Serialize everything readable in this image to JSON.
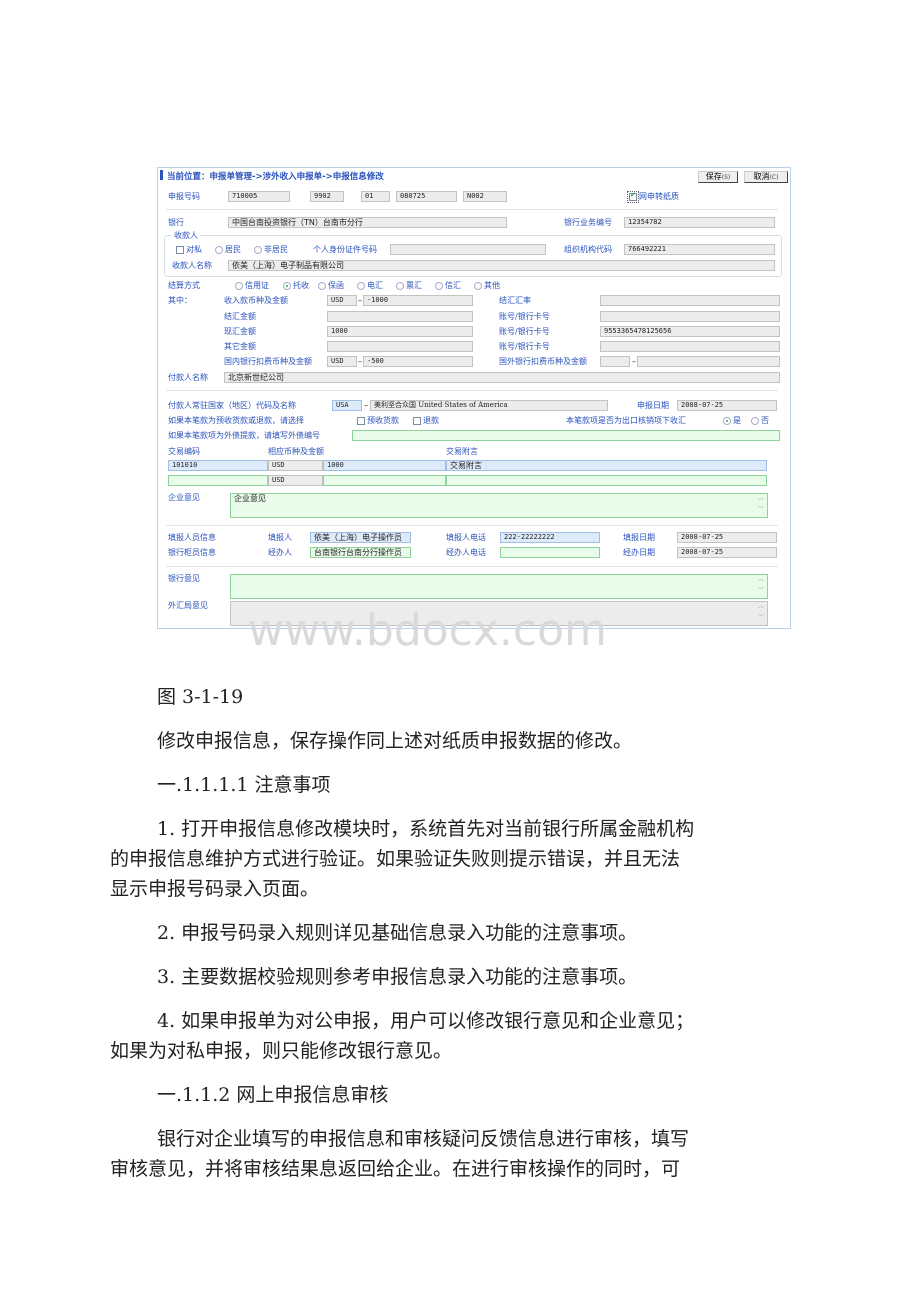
{
  "form": {
    "breadcrumb": "当前位置：申报单管理->涉外收入申报单->申报信息修改",
    "buttons": {
      "save": "保存",
      "save_key": "(S)",
      "cancel": "取消",
      "cancel_key": "(C)"
    },
    "declaration_no": {
      "label": "申报号码",
      "parts": [
        "710005",
        "9902",
        "01",
        "080725",
        "N002"
      ]
    },
    "paper_convert": {
      "label": "网申转纸质",
      "checked": true
    },
    "bank": {
      "label": "银行",
      "value": "中国台南投资银行（TN）台南市分行",
      "biz_no_label": "银行业务编号",
      "biz_no": "12354782"
    },
    "payee": {
      "group_label": "收款人",
      "private_label": "对私",
      "private_checked": false,
      "resident_label": "居民",
      "nonresident_label": "非居民",
      "id_label": "个人身份证件号码",
      "id_value": "",
      "org_code_label": "组织机构代码",
      "org_code": "766492221",
      "name_label": "收款人名称",
      "name": "依美（上海）电子制品有限公司"
    },
    "settlement": {
      "label": "结算方式",
      "options": [
        "信用证",
        "托收",
        "保函",
        "电汇",
        "票汇",
        "信汇",
        "其他"
      ],
      "selected": "托收"
    },
    "amounts": {
      "section_label": "其中：",
      "income_label": "收入款币种及金额",
      "income_currency": "USD",
      "income_amount": "-1000",
      "fx_rate_label": "结汇汇率",
      "fx_rate": "",
      "settle_label": "结汇金额",
      "settle_value": "",
      "account_label_1": "账号/银行卡号",
      "account_1": "",
      "spot_label": "现汇金额",
      "spot_value": "1000",
      "account_label_2": "账号/银行卡号",
      "account_2": "9553365478125656",
      "other_label": "其它金额",
      "other_value": "",
      "account_label_3": "账号/银行卡号",
      "account_3": "",
      "domestic_fee_label": "国内银行扣费币种及金额",
      "domestic_fee_currency": "USD",
      "domestic_fee_amount": "-500",
      "foreign_fee_label": "国外银行扣费币种及金额",
      "foreign_fee_currency": "",
      "foreign_fee_amount": ""
    },
    "payer": {
      "label": "付款人名称",
      "value": "北京新世纪公司"
    },
    "country": {
      "label": "付款人常驻国家（地区）代码及名称",
      "code": "USA",
      "name": "美利坚合众国 United States of America",
      "date_label": "申报日期",
      "date": "2008-07-25"
    },
    "advance": {
      "label": "如果本笔款为预收货款或退款，请选择",
      "advance_label": "预收货款",
      "refund_label": "退款",
      "export_label": "本笔款项是否为出口核销项下收汇",
      "yes": "是",
      "no": "否",
      "export_selected": "是"
    },
    "foreign_debt": {
      "label": "如果本笔款项为外债提款，请填写外债编号",
      "value": ""
    },
    "transaction": {
      "code_header": "交易编码",
      "amount_header": "相应币种及金额",
      "note_header": "交易附言",
      "rows": [
        {
          "code": "101010",
          "currency": "USD",
          "amount": "1000",
          "note": "交易附言"
        },
        {
          "code": "",
          "currency": "USD",
          "amount": "",
          "note": ""
        }
      ]
    },
    "enterprise_opinion": {
      "label": "企业意见",
      "value": "企业意见"
    },
    "filler": {
      "section": "填报人员信息",
      "label": "填报人",
      "value": "依美（上海）电子操作员",
      "phone_label": "填报人电话",
      "phone": "222-22222222",
      "date_label": "填报日期",
      "date": "2008-07-25"
    },
    "clerk": {
      "section": "银行柜员信息",
      "label": "经办人",
      "value": "台南银行台南分行操作员",
      "phone_label": "经办人电话",
      "phone": "",
      "date_label": "经办日期",
      "date": "2008-07-25"
    },
    "bank_opinion": {
      "label": "银行意见",
      "value": ""
    },
    "safe_opinion": {
      "label": "外汇局意见",
      "value": ""
    }
  },
  "watermark": "www.bdocx.com",
  "document": {
    "caption": "图 3-1-19",
    "p1": "修改申报信息，保存操作同上述对纸质申报数据的修改。",
    "h1": "一.1.1.1.1 注意事项",
    "item1_line1": "1. 打开申报信息修改模块时，系统首先对当前银行所属金融机构",
    "item1_line2": "的申报信息维护方式进行验证。如果验证失败则提示错误，并且无法",
    "item1_line3": "显示申报号码录入页面。",
    "item2": "2. 申报号码录入规则详见基础信息录入功能的注意事项。",
    "item3": "3. 主要数据校验规则参考申报信息录入功能的注意事项。",
    "item4_line1": "4. 如果申报单为对公申报，用户可以修改银行意见和企业意见；",
    "item4_line2": "如果为对私申报，则只能修改银行意见。",
    "h2": "一.1.1.2 网上申报信息审核",
    "p2_line1": "银行对企业填写的申报信息和审核疑问反馈信息进行审核，填写",
    "p2_line2": "审核意见，并将审核结果息返回给企业。在进行审核操作的同时，可"
  }
}
